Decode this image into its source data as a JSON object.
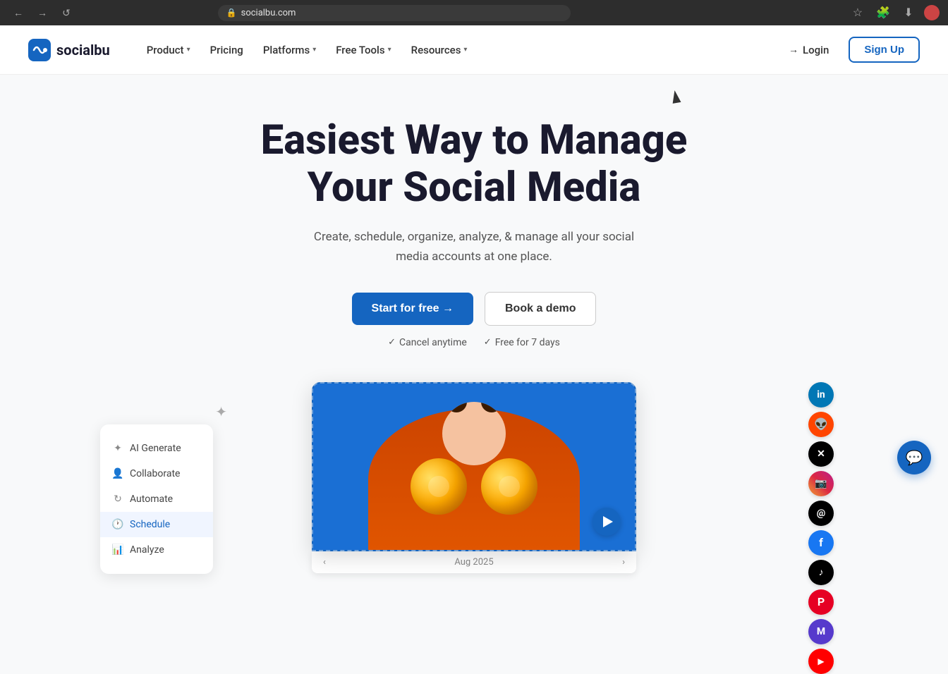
{
  "browser": {
    "url": "socialbu.com",
    "back_icon": "←",
    "forward_icon": "→",
    "reload_icon": "↺"
  },
  "navbar": {
    "logo_text": "socialbu",
    "nav_items": [
      {
        "label": "Product",
        "has_dropdown": true
      },
      {
        "label": "Pricing",
        "has_dropdown": false
      },
      {
        "label": "Platforms",
        "has_dropdown": true
      },
      {
        "label": "Free Tools",
        "has_dropdown": true
      },
      {
        "label": "Resources",
        "has_dropdown": true
      }
    ],
    "login_label": "Login",
    "signup_label": "Sign Up"
  },
  "hero": {
    "title_line1": "Easiest Way to Manage",
    "title_line2": "Your Social Media",
    "subtitle": "Create, schedule, organize, analyze, & manage all your social media accounts at one place.",
    "start_btn": "Start for free →",
    "demo_btn": "Book a demo",
    "check1": "Cancel anytime",
    "check2": "Free for 7 days"
  },
  "sidebar_panel": {
    "items": [
      {
        "label": "AI Generate",
        "icon": "✦"
      },
      {
        "label": "Collaborate",
        "icon": "👤"
      },
      {
        "label": "Automate",
        "icon": "↻"
      },
      {
        "label": "Schedule",
        "icon": "🕐",
        "active": true
      },
      {
        "label": "Analyze",
        "icon": "📊"
      }
    ]
  },
  "social_platforms": [
    {
      "name": "linkedin",
      "class": "si-linkedin",
      "icon": "in"
    },
    {
      "name": "reddit",
      "class": "si-reddit",
      "icon": "🔴"
    },
    {
      "name": "twitter",
      "class": "si-twitter",
      "icon": "✕"
    },
    {
      "name": "instagram",
      "class": "si-instagram",
      "icon": "📷"
    },
    {
      "name": "threads",
      "class": "si-threads",
      "icon": "@"
    },
    {
      "name": "facebook",
      "class": "si-facebook",
      "icon": "f"
    },
    {
      "name": "tiktok",
      "class": "si-tiktok",
      "icon": "♪"
    },
    {
      "name": "pinterest",
      "class": "si-pinterest",
      "icon": "P"
    },
    {
      "name": "mastodon",
      "class": "si-mastodon",
      "icon": "M"
    },
    {
      "name": "youtube",
      "class": "si-youtube",
      "icon": "▶"
    }
  ],
  "date_bar": {
    "date_label": "Aug 2025",
    "prev_icon": "‹",
    "next_icon": "›"
  }
}
